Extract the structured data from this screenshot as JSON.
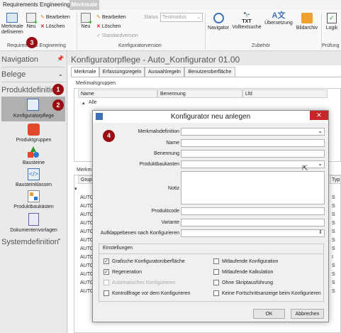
{
  "app": {
    "tab": "Requirements Engineering",
    "ribbon_tab": "Merkmale"
  },
  "ribbon": {
    "merkmale_definieren": "Merkmale definieren",
    "neu1": "Neu",
    "bearbeiten1": "Bearbeiten",
    "loeschen1": "Löschen",
    "group1": "Requirements Engineering",
    "neu2": "Neu",
    "bearbeiten2": "Bearbeiten",
    "loeschen2": "Löschen",
    "standardversion": "Standardversion",
    "status_label": "Status",
    "status_value": "Testmodus",
    "group2": "Konfiguratorversion",
    "navigator": "Navigator",
    "volltextsuche": "Volltextsuche",
    "uebersetzung": "Übersetzung",
    "bildarchiv": "Bildarchiv",
    "logik": "Logik",
    "group3": "Zubehör",
    "group4": "Prüfung"
  },
  "sidebar": {
    "navigation": "Navigation",
    "belege": "Belege",
    "produktdefinition": "Produktdefinition",
    "items": [
      "Konfiguratorpflege",
      "Produktgruppen",
      "Bausteine",
      "Bausteinklassen",
      "Produktbaukästen",
      "Dokumentenvorlagen"
    ],
    "systemdefinition": "Systemdefinition"
  },
  "badges": [
    "1",
    "2",
    "3",
    "4"
  ],
  "main": {
    "title": "Konfiguratorpflege - Auto_Konfigurator 01.00",
    "tabs": [
      "Merkmale",
      "Erfassungsregeln",
      "Auswahlregeln",
      "Benutzeroberfläche"
    ],
    "panel1": "Merkmalsgruppen",
    "cols": [
      "Name",
      "Benennung",
      "Lfd"
    ],
    "tree_root": "Alle",
    "panel2": "Merkm",
    "grid2_col": "Grupp",
    "grid2_last_col": "Typ",
    "rows": [
      "AUTO",
      "AUTO",
      "AUTO",
      "AUTO",
      "AUTO",
      "AUTO",
      "AUTO",
      "AUTO",
      "AUTO",
      "AUTO",
      "AUTO",
      "AUTO"
    ],
    "types": [
      "S",
      "S",
      "S",
      "S",
      "S",
      "S",
      "S",
      "I",
      "S",
      "S",
      "S",
      "S"
    ]
  },
  "dialog": {
    "title": "Konfigurator neu anlegen",
    "fields": [
      "Merkmalsdefinition",
      "Name",
      "Benennung",
      "Produktbaukasten",
      "Notiz",
      "Produktcode",
      "Variante",
      "Aufklappebenen nach Konfigurieren"
    ],
    "settings_title": "Einstellungen",
    "left_checks": [
      "Grafische Konfiguratoroberfläche",
      "Regeneration",
      "Automatisches Konfigurieren",
      "Kontrollfrage vor dem Konfigurieren"
    ],
    "right_checks": [
      "Mitlaufende Konfiguration",
      "Mitlaufende Kalkulation",
      "Ohne Skriptausführung",
      "Keine Fortschrittsanzeige beim Konfigurieren"
    ],
    "ok": "OK",
    "cancel": "Abbrechen"
  }
}
